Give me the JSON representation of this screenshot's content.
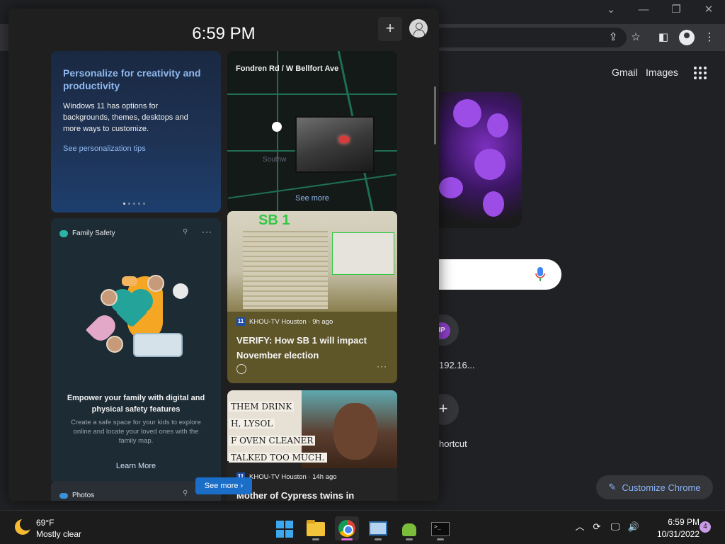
{
  "chrome": {
    "gmail_link": "Gmail",
    "images_link": "Images",
    "customize_label": "Customize Chrome",
    "shortcut_ip_initials": "IP",
    "shortcut_ip_label": "192.16...",
    "add_shortcut_label": "hortcut"
  },
  "widgets": {
    "clock": "6:59 PM",
    "personalize": {
      "title": "Personalize for creativity and productivity",
      "body": "Windows 11 has options for backgrounds, themes, desktops and more ways to customize.",
      "link": "See personalization tips"
    },
    "traffic": {
      "title": "Fondren Rd / W Bellfort Ave",
      "see_more": "See more"
    },
    "family": {
      "header": "Family Safety",
      "heading": "Empower your family with digital and physical safety features",
      "description": "Create a safe space for your kids to explore online and locate your loved ones with the family map.",
      "learn_more": "Learn More"
    },
    "news1": {
      "image_text": "SB 1",
      "source": "KHOU-TV Houston · 9h ago",
      "headline": "VERIFY: How SB 1 will impact November election"
    },
    "news2": {
      "image_words": [
        "THEM DRINK",
        "H, LYSOL",
        "F OVEN CLEANER",
        "TALKED TOO MUCH."
      ],
      "source": "KHOU-TV Houston · 14h ago",
      "headline": "Mother of Cypress twins in"
    },
    "photos": {
      "header": "Photos"
    },
    "see_more_button": "See more ›"
  },
  "taskbar": {
    "weather_temp": "69°F",
    "weather_desc": "Mostly clear",
    "time": "6:59 PM",
    "date": "10/31/2022",
    "notification_count": "4"
  },
  "colors": {
    "accent_blue": "#8ab4f8",
    "widget_link": "#8fb8ef",
    "see_more_bg": "#1a6ec7",
    "chrome_active": "#e56bd6"
  }
}
